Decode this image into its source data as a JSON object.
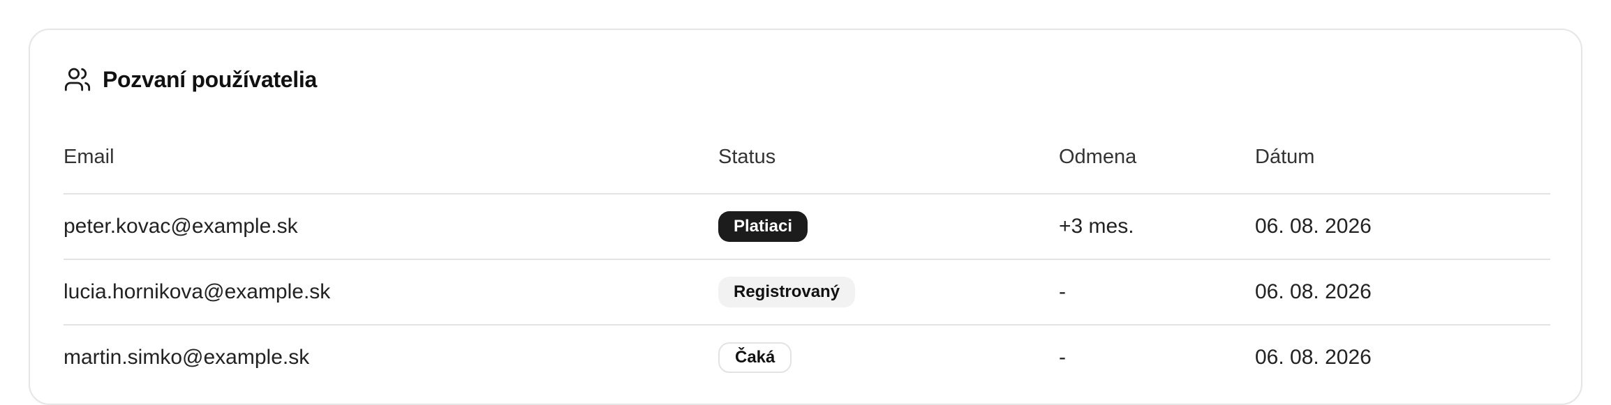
{
  "card": {
    "icon": "users-icon",
    "title": "Pozvaní používatelia"
  },
  "table": {
    "headers": {
      "email": "Email",
      "status": "Status",
      "reward": "Odmena",
      "date": "Dátum"
    },
    "rows": [
      {
        "email": "peter.kovac@example.sk",
        "status": "Platiaci",
        "status_style": "dark",
        "reward": "+3 mes.",
        "date": "06. 08. 2026"
      },
      {
        "email": "lucia.hornikova@example.sk",
        "status": "Registrovaný",
        "status_style": "light",
        "reward": "-",
        "date": "06. 08. 2026"
      },
      {
        "email": "martin.simko@example.sk",
        "status": "Čaká",
        "status_style": "outline",
        "reward": "-",
        "date": "06. 08. 2026"
      }
    ]
  },
  "colors": {
    "badge_dark": "#1c1c1c",
    "badge_light": "#f2f2f2",
    "border": "#e3e3e3"
  }
}
